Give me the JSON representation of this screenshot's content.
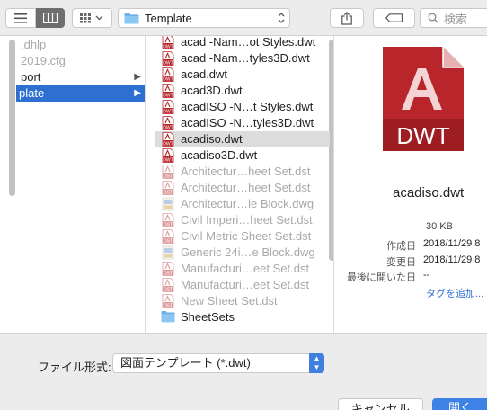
{
  "toolbar": {
    "path_label": "Template",
    "search_placeholder": "検索",
    "icons": [
      "list-view-icon",
      "column-view-icon",
      "arrange-icon",
      "folder-icon",
      "share-icon",
      "tag-icon",
      "search-icon"
    ]
  },
  "sidebar": {
    "items": [
      {
        "label": ".dhlp",
        "state": "gray"
      },
      {
        "label": "2019.cfg",
        "state": "gray"
      },
      {
        "label": "port",
        "state": "normal",
        "has_children": true
      },
      {
        "label": "plate",
        "state": "selected",
        "has_children": true
      }
    ]
  },
  "files": [
    {
      "name": "acad -Nam…ot Styles.dwt",
      "type": "dwt",
      "enabled": true
    },
    {
      "name": "acad -Nam…tyles3D.dwt",
      "type": "dwt",
      "enabled": true
    },
    {
      "name": "acad.dwt",
      "type": "dwt",
      "enabled": true
    },
    {
      "name": "acad3D.dwt",
      "type": "dwt",
      "enabled": true
    },
    {
      "name": "acadISO -N…t Styles.dwt",
      "type": "dwt",
      "enabled": true
    },
    {
      "name": "acadISO -N…tyles3D.dwt",
      "type": "dwt",
      "enabled": true
    },
    {
      "name": "acadiso.dwt",
      "type": "dwt",
      "enabled": true,
      "highlighted": true
    },
    {
      "name": "acadiso3D.dwt",
      "type": "dwt",
      "enabled": true
    },
    {
      "name": "Architectur…heet Set.dst",
      "type": "dst",
      "enabled": false
    },
    {
      "name": "Architectur…heet Set.dst",
      "type": "dst",
      "enabled": false
    },
    {
      "name": "Architectur…le Block.dwg",
      "type": "dwg",
      "enabled": false
    },
    {
      "name": "Civil Imperi…heet Set.dst",
      "type": "dst",
      "enabled": false
    },
    {
      "name": "Civil Metric Sheet Set.dst",
      "type": "dst",
      "enabled": false
    },
    {
      "name": "Generic 24i…e Block.dwg",
      "type": "dwg",
      "enabled": false
    },
    {
      "name": "Manufacturi…eet Set.dst",
      "type": "dst",
      "enabled": false
    },
    {
      "name": "Manufacturi…eet Set.dst",
      "type": "dst",
      "enabled": false
    },
    {
      "name": "New Sheet Set.dst",
      "type": "dst",
      "enabled": false
    },
    {
      "name": "SheetSets",
      "type": "folder",
      "enabled": true
    }
  ],
  "preview": {
    "icon_text": "DWT",
    "filename": "acadiso.dwt",
    "size": "30 KB",
    "created_label": "作成日",
    "created_value": "2018/11/29 8",
    "modified_label": "変更日",
    "modified_value": "2018/11/29 8",
    "last_opened_label": "最後に開いた日",
    "last_opened_value": "--",
    "add_tags": "タグを追加..."
  },
  "bottom": {
    "format_label": "ファイル形式:",
    "format_value": "図面テンプレート (*.dwt)",
    "cancel_label": "キャンセル",
    "open_label": "開く"
  },
  "colors": {
    "selection": "#2e6fd2",
    "dwt_red": "#b8262b",
    "primary_button": "#3f82e6"
  }
}
